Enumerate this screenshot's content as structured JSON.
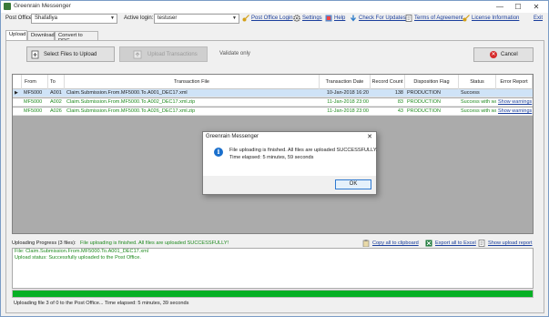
{
  "window": {
    "title": "Greenrain Messenger",
    "min": "—",
    "max": "☐",
    "close": "✕"
  },
  "toolbar": {
    "post_office_label": "Post Office:",
    "post_office_value": "Shafafiya",
    "active_login_label": "Active login:",
    "active_login_value": "testuser",
    "links": {
      "post_office_login": "Post Office Login",
      "settings": "Settings",
      "help": "Help",
      "check_updates": "Check For Updates",
      "terms": "Terms of Agreement",
      "license": "License Information",
      "exit": "Exit"
    }
  },
  "tabs": [
    "Upload",
    "Download",
    "Convert to DRG"
  ],
  "upload": {
    "select_files": "Select Files to Upload",
    "upload_transactions": "Upload Transactions",
    "validate_only": "Validate only",
    "cancel": "Cancel"
  },
  "grid": {
    "headers": {
      "from": "From",
      "to": "To",
      "file": "Transaction File",
      "date": "Transaction Date",
      "count": "Record Count",
      "flag": "Disposition Flag",
      "status": "Status",
      "error": "Error Report"
    },
    "rows": [
      {
        "marker": "▶",
        "from": "MF5000",
        "to": "A001",
        "file": "Claim.Submission.From.MF5000.To.A001_DEC17.xml",
        "date": "10-Jan-2018 16:20",
        "count": "138",
        "flag": "PRODUCTION",
        "status": "Success",
        "error": ""
      },
      {
        "marker": "",
        "from": "MF5000",
        "to": "A002",
        "file": "Claim.Submission.From.MF5000.To.A002_DEC17.xml.zip",
        "date": "11-Jan-2018 23:00",
        "count": "83",
        "flag": "PRODUCTION",
        "status": "Success with warnings",
        "error": "Show warnings"
      },
      {
        "marker": "",
        "from": "MF5000",
        "to": "A026",
        "file": "Claim.Submission.From.MF5000.To.A026_DEC17.xml.zip",
        "date": "11-Jan-2018 23:00",
        "count": "43",
        "flag": "PRODUCTION",
        "status": "Success with warnings",
        "error": "Show warnings"
      }
    ]
  },
  "dialog": {
    "title": "Greenrain Messenger",
    "close": "✕",
    "line1": "File uploading is finished. All files are uploaded SUCCESSFULLY.",
    "line2": "Time elapsed: 5 minutes, 59 seconds",
    "ok": "OK"
  },
  "progress": {
    "label": "Uploading Progress (3 files):",
    "message": "File uploading is finished. All files are uploaded SUCCESSFULLY!",
    "copy_clipboard": "Copy all to clipboard",
    "export_excel": "Export all to Excel",
    "show_report": "Show upload report",
    "log": [
      "File: Claim.Submission.From.MF5000.To.A001_DEC17.xml",
      "Upload status: Successfully uploaded to the Post Office."
    ],
    "percent": 100
  },
  "status_bar": "Uploading file 3 of 0 to the Post Office... Time elapsed: 5 minutes, 39 seconds",
  "colors": {
    "green": "#1f8a1f",
    "progress": "#06b025",
    "link": "#1a3e9c"
  }
}
